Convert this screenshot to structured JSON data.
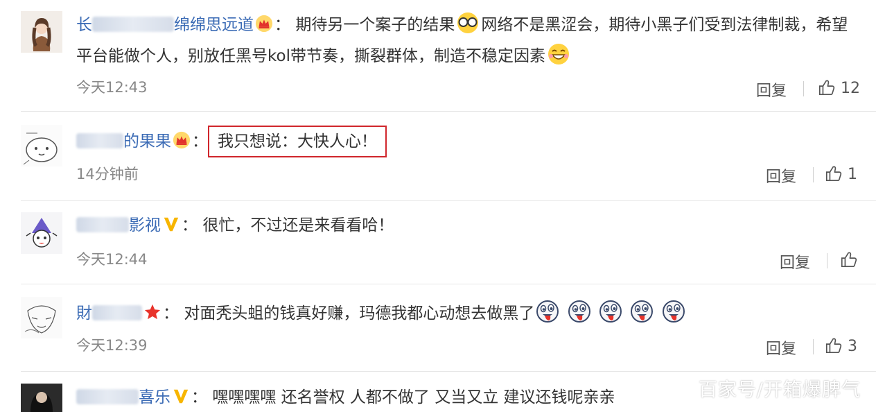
{
  "comments": [
    {
      "username_visible": "绵绵思远道",
      "username_prefix": "长",
      "badge": "crown",
      "colon": "：",
      "text_parts": [
        "期待另一个案子的结果",
        "网络不是黑涩会，期待小黑子们受到法律制裁，希望",
        "平台能做个人，别放任黑号kol带节奏，撕裂群体，制造不稳定因素"
      ],
      "time": "今天12:43",
      "reply": "回复",
      "likes": "12"
    },
    {
      "username_visible": "的果果",
      "badge": "crown",
      "colon": "：",
      "text": "我只想说：大快人心！",
      "time": "14分钟前",
      "reply": "回复",
      "likes": "1"
    },
    {
      "username_visible": "影视",
      "badge": "verified-v",
      "colon": "：",
      "text": "很忙，不过还是来看看哈！",
      "time": "今天12:44",
      "reply": "回复",
      "likes": ""
    },
    {
      "username_prefix": "財",
      "badge": "star",
      "colon": "：",
      "text": "对面秃头蛆的钱真好赚，玛德我都心动想去做黑了",
      "time": "今天12:39",
      "reply": "回复",
      "likes": "3"
    },
    {
      "username_visible": "喜乐",
      "badge": "verified-v",
      "colon": "：",
      "text": "嘿嘿嘿嘿 还名誉权 人都不做了 又当又立 建议还钱呢亲亲"
    }
  ],
  "watermark": "百家号/开箱爆脾气",
  "colors": {
    "username": "#3b6bb5",
    "highlight_border": "#d0262c",
    "time": "#888888",
    "crown": "#f5a623",
    "verified": "#f7b500",
    "star": "#e8332b"
  },
  "icons": [
    "crown-badge-icon",
    "verified-v-icon",
    "star-badge-icon",
    "thumbs-up-icon",
    "sunglasses-emoji-icon",
    "grin-emoji-icon",
    "tongue-emoji-icon"
  ]
}
